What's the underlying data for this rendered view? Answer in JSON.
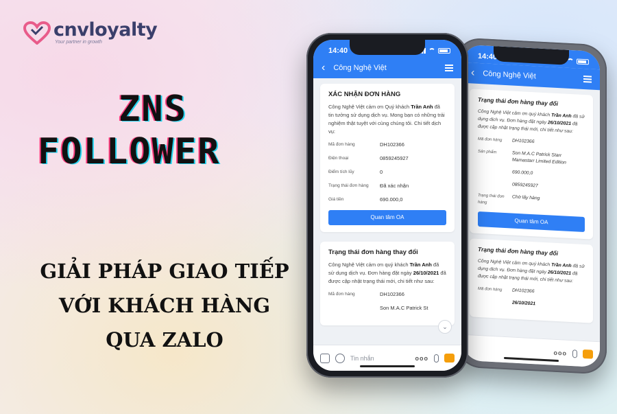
{
  "logo": {
    "brand": "cnvloyalty",
    "tagline": "Your partner in growth"
  },
  "headline": {
    "line1": "ZNS",
    "line2": "FOLLOWER"
  },
  "subtitle": {
    "line1": "GIẢI PHÁP GIAO TIẾP",
    "line2": "VỚI KHÁCH HÀNG",
    "line3": "QUA ZALO"
  },
  "colors": {
    "zalo_blue": "#2f7ff5",
    "headline_pink": "#ff3d7f",
    "headline_cyan": "#22d3ee"
  },
  "front_phone": {
    "time": "14:40",
    "chat_title": "Công Nghệ Việt",
    "card1": {
      "title": "XÁC NHẬN ĐƠN HÀNG",
      "body_pre": "Công Nghệ Việt cảm ơn Quý khách ",
      "customer": "Trần Anh",
      "body_post": " đã tin tưởng sử dụng dịch vụ. Mong bạn có những trải nghiệm thật tuyệt với cùng chúng tôi. Chi tiết dịch vụ:",
      "rows": [
        {
          "k": "Mã đơn hàng",
          "v": "DH102366"
        },
        {
          "k": "Điện thoại",
          "v": "0859245927"
        },
        {
          "k": "Điểm tích lũy",
          "v": "0"
        },
        {
          "k": "Trạng thái đơn hàng",
          "v": "Đã xác nhận"
        },
        {
          "k": "Giá tiền",
          "v": "690.000,0"
        }
      ],
      "cta": "Quan tâm OA"
    },
    "card2": {
      "title": "Trạng thái đơn hàng thay đổi",
      "body_pre": "Công Nghệ Việt cảm ơn quý khách ",
      "customer": "Trần Anh",
      "body_mid": " đã sử dụng dịch vụ. Đơn hàng đặt ngày ",
      "date": "26/10/2021",
      "body_post": " đã được cập nhật trạng thái mới, chi tiết như sau:",
      "rows": [
        {
          "k": "Mã đơn hàng",
          "v": "DH102366"
        }
      ],
      "trailing": "Son M.A.C Patrick St"
    },
    "composer": {
      "placeholder": "Tin nhắn",
      "dots": "ooo"
    }
  },
  "back_phone": {
    "time": "14:40",
    "chat_title": "Công Nghệ Việt",
    "card1": {
      "title": "Trạng thái đơn hàng thay đổi",
      "body_pre": "Công Nghệ Việt cảm ơn quý khách ",
      "customer": "Trần Anh",
      "body_mid": " đã sử dụng dịch vụ. Đơn hàng đặt ngày ",
      "date": "26/10/2021",
      "body_post": " đã được cập nhật trạng thái mới, chi tiết như sau:",
      "rows": [
        {
          "k": "Mã đơn hàng",
          "v": "DH102366"
        },
        {
          "k": "Sản phẩm",
          "v": "Son M.A.C Patrick Starr Mamastarr Limited Edition"
        },
        {
          "k": "",
          "v": "690.000,0"
        },
        {
          "k": "",
          "v": "0859245927"
        },
        {
          "k": "Trạng thái đơn hàng",
          "v": "Chờ lấy hàng"
        }
      ],
      "cta": "Quan tâm OA"
    },
    "card2": {
      "title": "Trạng thái đơn hàng thay đổi",
      "body_pre": "Công Nghệ Việt cảm ơn quý khách ",
      "customer": "Trần Anh",
      "body_mid": " đã sử dụng dịch vụ. Đơn hàng đặt ngày ",
      "date": "26/10/2021",
      "body_post": " đã được cập nhật trạng thái mới, chi tiết như sau:",
      "rows": [
        {
          "k": "Mã đơn hàng",
          "v": "DH102366"
        }
      ],
      "date_short": "26/10/2021"
    }
  }
}
